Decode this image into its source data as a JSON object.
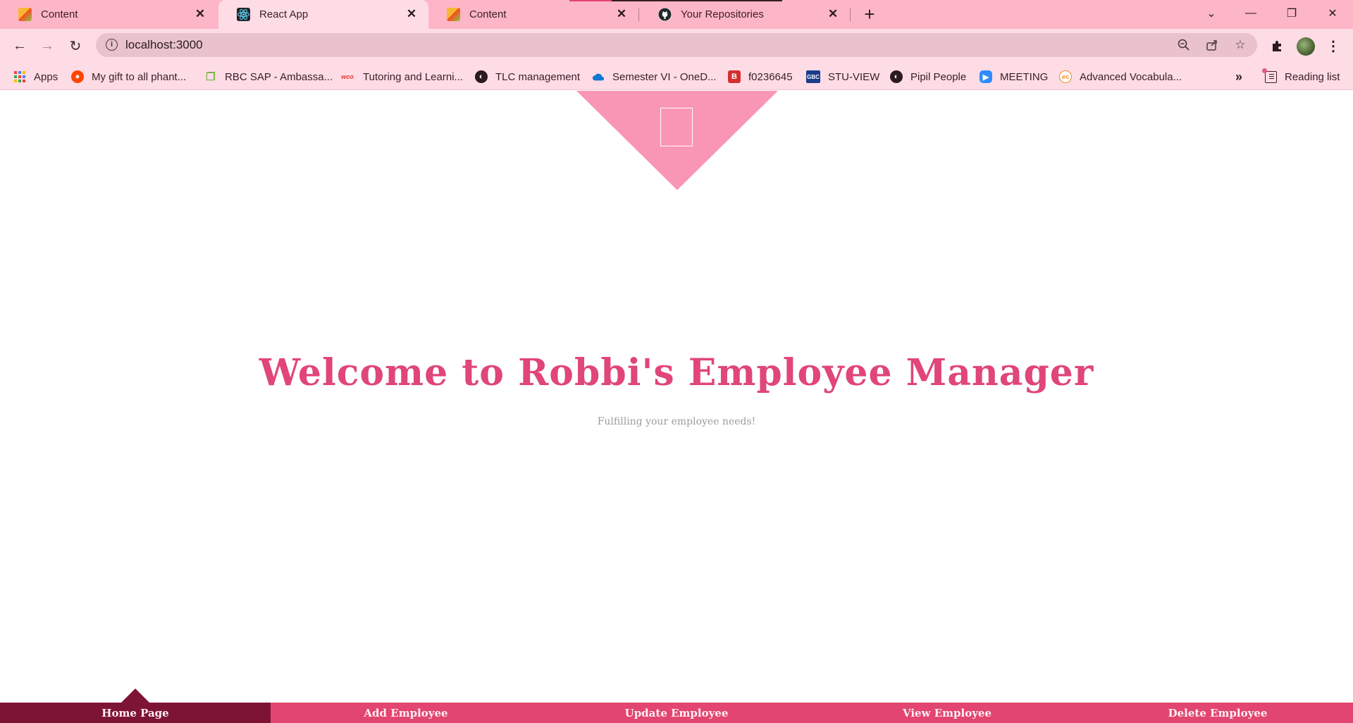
{
  "browser": {
    "tabs": [
      {
        "title": "Content",
        "active": false
      },
      {
        "title": "React App",
        "active": true
      },
      {
        "title": "Content",
        "active": false
      },
      {
        "title": "Your Repositories",
        "active": false
      }
    ],
    "url": "localhost:3000",
    "bookmarks": [
      {
        "label": "Apps",
        "icon": "apps-grid-icon"
      },
      {
        "label": "My gift to all phant...",
        "icon": "reddit-icon"
      },
      {
        "label": "RBC SAP - Ambassa...",
        "icon": "chat-bubbles-icon"
      },
      {
        "label": "Tutoring and Learni...",
        "icon": "wco-icon"
      },
      {
        "label": "TLC management",
        "icon": "globe-icon"
      },
      {
        "label": "Semester VI - OneD...",
        "icon": "onedrive-cloud-icon"
      },
      {
        "label": "f0236645",
        "icon": "b-icon"
      },
      {
        "label": "STU-VIEW",
        "icon": "gbc-icon"
      },
      {
        "label": "Pipil People",
        "icon": "globe-icon"
      },
      {
        "label": "MEETING",
        "icon": "zoom-camera-icon"
      },
      {
        "label": "Advanced Vocabula...",
        "icon": "ec-icon"
      }
    ],
    "reading_list": "Reading list"
  },
  "page": {
    "title": "Welcome to Robbi's Employee Manager",
    "tagline": "Fulfilling your employee needs!"
  },
  "nav": {
    "items": [
      "Home Page",
      "Add Employee",
      "Update Employee",
      "View Employee",
      "Delete Employee"
    ],
    "active_index": 0
  },
  "colors": {
    "tab_strip": "#fdb6c7",
    "toolbar": "#fedce5",
    "logo_pink": "#f996b6",
    "headline": "#e0457b",
    "nav_bar": "#e2456f",
    "nav_active": "#7e1434"
  }
}
